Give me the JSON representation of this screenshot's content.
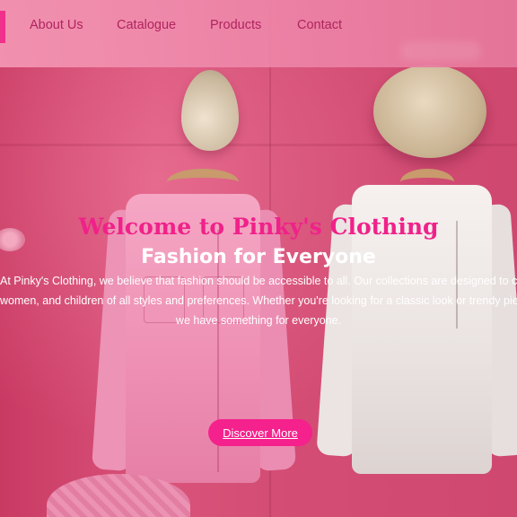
{
  "nav": {
    "links": [
      "About Us",
      "Catalogue",
      "Products",
      "Contact"
    ]
  },
  "hero": {
    "title": "Welcome to Pinky's Clothing",
    "subtitle": "Fashion for Everyone",
    "lines": [
      "At Pinky's Clothing, we believe that fashion should be accessible to all. Our collections are designed to cater to men,",
      "women, and children of all styles and preferences. Whether you're looking for a classic look or trendy pieces,",
      "we have something for everyone."
    ],
    "cta": "Discover More"
  },
  "colors": {
    "accent": "#f5218c",
    "title": "#f0218a",
    "nav_text": "#b0245e",
    "background": "#d8456f"
  }
}
